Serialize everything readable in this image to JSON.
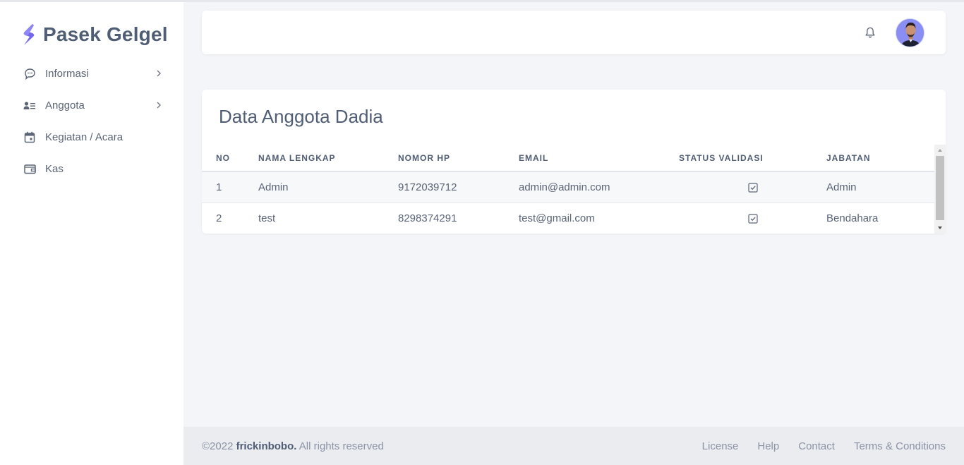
{
  "brand": {
    "name": "Pasek Gelgel",
    "logo_icon": "bolt-s-logo",
    "accent": "#7367f0"
  },
  "sidebar": {
    "items": [
      {
        "label": "Informasi",
        "icon": "chat-bubble-icon",
        "has_chevron": true
      },
      {
        "label": "Anggota",
        "icon": "user-list-icon",
        "has_chevron": true
      },
      {
        "label": "Kegiatan / Acara",
        "icon": "calendar-icon",
        "has_chevron": false
      },
      {
        "label": "Kas",
        "icon": "wallet-icon",
        "has_chevron": false
      }
    ]
  },
  "header": {
    "notification_icon": "bell-icon",
    "avatar": "user-avatar"
  },
  "card": {
    "title": "Data Anggota Dadia",
    "columns": [
      "NO",
      "NAMA LENGKAP",
      "NOMOR HP",
      "EMAIL",
      "STATUS VALIDASI",
      "JABATAN"
    ],
    "rows": [
      {
        "no": "1",
        "name": "Admin",
        "phone": "9172039712",
        "email": "admin@admin.com",
        "validated": true,
        "role": "Admin"
      },
      {
        "no": "2",
        "name": "test",
        "phone": "8298374291",
        "email": "test@gmail.com",
        "validated": true,
        "role": "Bendahara"
      }
    ]
  },
  "footer": {
    "year": "©2022",
    "author": "frickinbobo.",
    "rights": "All rights reserved",
    "links": [
      "License",
      "Help",
      "Contact",
      "Terms & Conditions"
    ]
  }
}
